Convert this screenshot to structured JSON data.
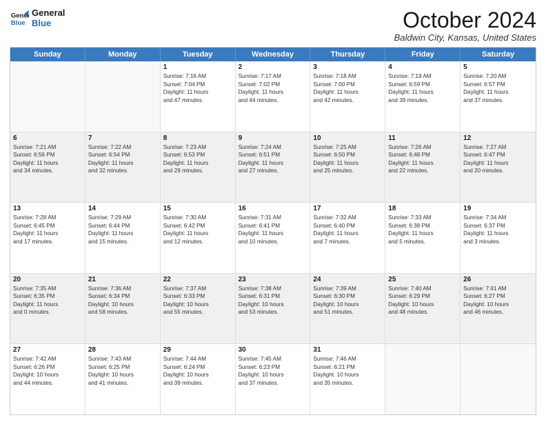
{
  "header": {
    "logo_line1": "General",
    "logo_line2": "Blue",
    "month": "October 2024",
    "location": "Baldwin City, Kansas, United States"
  },
  "calendar": {
    "days_of_week": [
      "Sunday",
      "Monday",
      "Tuesday",
      "Wednesday",
      "Thursday",
      "Friday",
      "Saturday"
    ],
    "weeks": [
      [
        {
          "day": "",
          "empty": true,
          "shaded": false,
          "lines": []
        },
        {
          "day": "",
          "empty": true,
          "shaded": false,
          "lines": []
        },
        {
          "day": "1",
          "empty": false,
          "shaded": false,
          "lines": [
            "Sunrise: 7:16 AM",
            "Sunset: 7:04 PM",
            "Daylight: 11 hours",
            "and 47 minutes."
          ]
        },
        {
          "day": "2",
          "empty": false,
          "shaded": false,
          "lines": [
            "Sunrise: 7:17 AM",
            "Sunset: 7:02 PM",
            "Daylight: 11 hours",
            "and 44 minutes."
          ]
        },
        {
          "day": "3",
          "empty": false,
          "shaded": false,
          "lines": [
            "Sunrise: 7:18 AM",
            "Sunset: 7:00 PM",
            "Daylight: 11 hours",
            "and 42 minutes."
          ]
        },
        {
          "day": "4",
          "empty": false,
          "shaded": false,
          "lines": [
            "Sunrise: 7:19 AM",
            "Sunset: 6:59 PM",
            "Daylight: 11 hours",
            "and 39 minutes."
          ]
        },
        {
          "day": "5",
          "empty": false,
          "shaded": false,
          "lines": [
            "Sunrise: 7:20 AM",
            "Sunset: 6:57 PM",
            "Daylight: 11 hours",
            "and 37 minutes."
          ]
        }
      ],
      [
        {
          "day": "6",
          "empty": false,
          "shaded": true,
          "lines": [
            "Sunrise: 7:21 AM",
            "Sunset: 6:56 PM",
            "Daylight: 11 hours",
            "and 34 minutes."
          ]
        },
        {
          "day": "7",
          "empty": false,
          "shaded": true,
          "lines": [
            "Sunrise: 7:22 AM",
            "Sunset: 6:54 PM",
            "Daylight: 11 hours",
            "and 32 minutes."
          ]
        },
        {
          "day": "8",
          "empty": false,
          "shaded": true,
          "lines": [
            "Sunrise: 7:23 AM",
            "Sunset: 6:53 PM",
            "Daylight: 11 hours",
            "and 29 minutes."
          ]
        },
        {
          "day": "9",
          "empty": false,
          "shaded": true,
          "lines": [
            "Sunrise: 7:24 AM",
            "Sunset: 6:51 PM",
            "Daylight: 11 hours",
            "and 27 minutes."
          ]
        },
        {
          "day": "10",
          "empty": false,
          "shaded": true,
          "lines": [
            "Sunrise: 7:25 AM",
            "Sunset: 6:50 PM",
            "Daylight: 11 hours",
            "and 25 minutes."
          ]
        },
        {
          "day": "11",
          "empty": false,
          "shaded": true,
          "lines": [
            "Sunrise: 7:26 AM",
            "Sunset: 6:48 PM",
            "Daylight: 11 hours",
            "and 22 minutes."
          ]
        },
        {
          "day": "12",
          "empty": false,
          "shaded": true,
          "lines": [
            "Sunrise: 7:27 AM",
            "Sunset: 6:47 PM",
            "Daylight: 11 hours",
            "and 20 minutes."
          ]
        }
      ],
      [
        {
          "day": "13",
          "empty": false,
          "shaded": false,
          "lines": [
            "Sunrise: 7:28 AM",
            "Sunset: 6:45 PM",
            "Daylight: 11 hours",
            "and 17 minutes."
          ]
        },
        {
          "day": "14",
          "empty": false,
          "shaded": false,
          "lines": [
            "Sunrise: 7:29 AM",
            "Sunset: 6:44 PM",
            "Daylight: 11 hours",
            "and 15 minutes."
          ]
        },
        {
          "day": "15",
          "empty": false,
          "shaded": false,
          "lines": [
            "Sunrise: 7:30 AM",
            "Sunset: 6:42 PM",
            "Daylight: 11 hours",
            "and 12 minutes."
          ]
        },
        {
          "day": "16",
          "empty": false,
          "shaded": false,
          "lines": [
            "Sunrise: 7:31 AM",
            "Sunset: 6:41 PM",
            "Daylight: 11 hours",
            "and 10 minutes."
          ]
        },
        {
          "day": "17",
          "empty": false,
          "shaded": false,
          "lines": [
            "Sunrise: 7:32 AM",
            "Sunset: 6:40 PM",
            "Daylight: 11 hours",
            "and 7 minutes."
          ]
        },
        {
          "day": "18",
          "empty": false,
          "shaded": false,
          "lines": [
            "Sunrise: 7:33 AM",
            "Sunset: 6:38 PM",
            "Daylight: 11 hours",
            "and 5 minutes."
          ]
        },
        {
          "day": "19",
          "empty": false,
          "shaded": false,
          "lines": [
            "Sunrise: 7:34 AM",
            "Sunset: 6:37 PM",
            "Daylight: 11 hours",
            "and 3 minutes."
          ]
        }
      ],
      [
        {
          "day": "20",
          "empty": false,
          "shaded": true,
          "lines": [
            "Sunrise: 7:35 AM",
            "Sunset: 6:35 PM",
            "Daylight: 11 hours",
            "and 0 minutes."
          ]
        },
        {
          "day": "21",
          "empty": false,
          "shaded": true,
          "lines": [
            "Sunrise: 7:36 AM",
            "Sunset: 6:34 PM",
            "Daylight: 10 hours",
            "and 58 minutes."
          ]
        },
        {
          "day": "22",
          "empty": false,
          "shaded": true,
          "lines": [
            "Sunrise: 7:37 AM",
            "Sunset: 6:33 PM",
            "Daylight: 10 hours",
            "and 55 minutes."
          ]
        },
        {
          "day": "23",
          "empty": false,
          "shaded": true,
          "lines": [
            "Sunrise: 7:38 AM",
            "Sunset: 6:31 PM",
            "Daylight: 10 hours",
            "and 53 minutes."
          ]
        },
        {
          "day": "24",
          "empty": false,
          "shaded": true,
          "lines": [
            "Sunrise: 7:39 AM",
            "Sunset: 6:30 PM",
            "Daylight: 10 hours",
            "and 51 minutes."
          ]
        },
        {
          "day": "25",
          "empty": false,
          "shaded": true,
          "lines": [
            "Sunrise: 7:40 AM",
            "Sunset: 6:29 PM",
            "Daylight: 10 hours",
            "and 48 minutes."
          ]
        },
        {
          "day": "26",
          "empty": false,
          "shaded": true,
          "lines": [
            "Sunrise: 7:41 AM",
            "Sunset: 6:27 PM",
            "Daylight: 10 hours",
            "and 46 minutes."
          ]
        }
      ],
      [
        {
          "day": "27",
          "empty": false,
          "shaded": false,
          "lines": [
            "Sunrise: 7:42 AM",
            "Sunset: 6:26 PM",
            "Daylight: 10 hours",
            "and 44 minutes."
          ]
        },
        {
          "day": "28",
          "empty": false,
          "shaded": false,
          "lines": [
            "Sunrise: 7:43 AM",
            "Sunset: 6:25 PM",
            "Daylight: 10 hours",
            "and 41 minutes."
          ]
        },
        {
          "day": "29",
          "empty": false,
          "shaded": false,
          "lines": [
            "Sunrise: 7:44 AM",
            "Sunset: 6:24 PM",
            "Daylight: 10 hours",
            "and 39 minutes."
          ]
        },
        {
          "day": "30",
          "empty": false,
          "shaded": false,
          "lines": [
            "Sunrise: 7:45 AM",
            "Sunset: 6:23 PM",
            "Daylight: 10 hours",
            "and 37 minutes."
          ]
        },
        {
          "day": "31",
          "empty": false,
          "shaded": false,
          "lines": [
            "Sunrise: 7:46 AM",
            "Sunset: 6:21 PM",
            "Daylight: 10 hours",
            "and 35 minutes."
          ]
        },
        {
          "day": "",
          "empty": true,
          "shaded": false,
          "lines": []
        },
        {
          "day": "",
          "empty": true,
          "shaded": false,
          "lines": []
        }
      ]
    ]
  }
}
